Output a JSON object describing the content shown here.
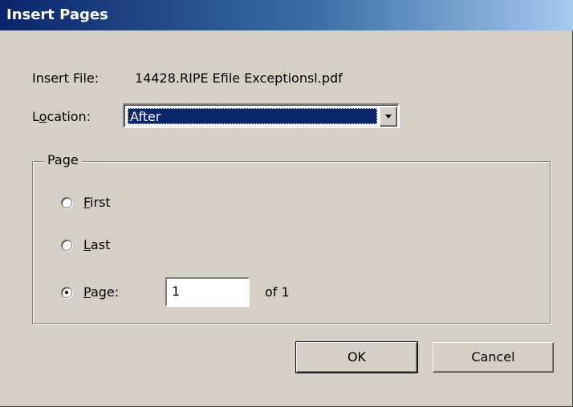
{
  "dialog": {
    "title": "Insert Pages",
    "insert_file_label": "Insert File:",
    "insert_file_value": "14428.RIPE Efile Exceptionsl.pdf",
    "location_label_pre": "L",
    "location_label_u": "o",
    "location_label_post": "cation:",
    "location_value": "After",
    "page_group_title": "Page",
    "radios": [
      {
        "u": "F",
        "rest": "irst",
        "checked": false
      },
      {
        "u": "L",
        "rest": "ast",
        "checked": false
      },
      {
        "u": "P",
        "rest": "age:",
        "checked": true
      }
    ],
    "page_value": "1",
    "of_text": "of 1",
    "ok_label": "OK",
    "cancel_label": "Cancel"
  },
  "colors": {
    "face": "#d4d0c8",
    "title_start": "#0a246a",
    "title_end": "#a6caf0",
    "selection": "#0a246a"
  },
  "icons": {
    "combo_arrow": "chevron-down-icon"
  }
}
